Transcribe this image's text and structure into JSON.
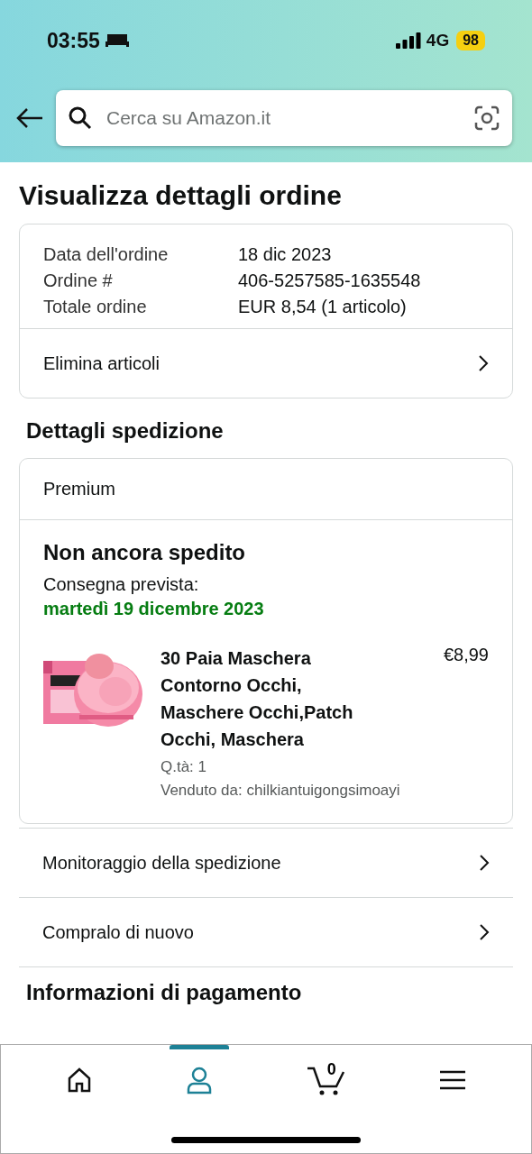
{
  "status_bar": {
    "time": "03:55",
    "network": "4G",
    "battery": "98"
  },
  "search": {
    "placeholder": "Cerca su Amazon.it"
  },
  "title": "Visualizza dettagli ordine",
  "order_summary": {
    "rows": [
      {
        "label": "Data dell'ordine",
        "value": "18 dic 2023"
      },
      {
        "label": "Ordine #",
        "value": "406-5257585-1635548"
      },
      {
        "label": "Totale ordine",
        "value": "EUR 8,54 (1 articolo)"
      }
    ],
    "action": "Elimina articoli"
  },
  "shipping": {
    "heading": "Dettagli spedizione",
    "tier": "Premium",
    "status": "Non ancora spedito",
    "delivery_label": "Consegna prevista:",
    "delivery_date": "martedì 19 dicembre 2023",
    "item": {
      "kind": "picture",
      "name": "30 Paia Maschera Contorno Occhi, Maschere Occhi,Patch Occhi, Maschera",
      "price": "€8,99",
      "quantity": "Q.tà: 1",
      "seller": "Venduto da: chilkiantuigongsimoayi"
    }
  },
  "actions": [
    "Monitoraggio della spedizione",
    "Compralo di nuovo"
  ],
  "next_heading": "Informazioni di pagamento",
  "nav": [
    {
      "kind": "home",
      "selected": false
    },
    {
      "kind": "account",
      "selected": true
    },
    {
      "kind": "cart",
      "selected": false,
      "count": "0"
    },
    {
      "kind": "menu",
      "selected": false
    }
  ]
}
